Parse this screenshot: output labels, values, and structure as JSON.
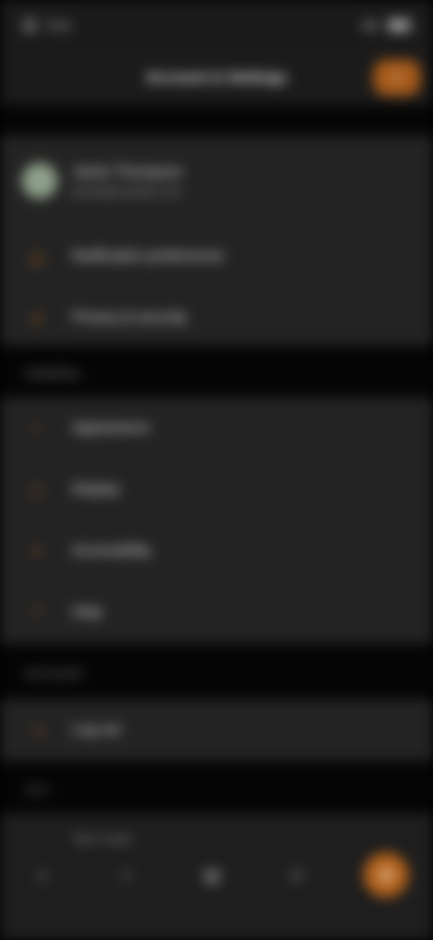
{
  "status_bar": {
    "left_text": "9:41",
    "right_text": "5G"
  },
  "header": {
    "title": "Account & Settings",
    "action_icon": "plus-icon"
  },
  "profile_card": {
    "name": "Jamie Thompson",
    "subtitle": "jamie@example.com",
    "items": [
      {
        "label": "Notification preferences",
        "icon": "bell-icon"
      },
      {
        "label": "Privacy & security",
        "icon": "lock-icon"
      }
    ]
  },
  "section_general": {
    "header": "GENERAL",
    "items": [
      {
        "label": "Appearance",
        "icon": "palette-icon"
      },
      {
        "label": "Display",
        "icon": "display-icon"
      },
      {
        "label": "Accessibility",
        "icon": "accessibility-icon"
      },
      {
        "label": "Help",
        "icon": "help-icon"
      }
    ]
  },
  "section_account": {
    "header": "ACCOUNT",
    "items": [
      {
        "label": "Log out",
        "icon": "logout-icon"
      }
    ]
  },
  "section_footer": {
    "header": "v2.3"
  },
  "bottom_nav": {
    "caption": "Tap to open",
    "items": [
      {
        "icon": "home-icon",
        "glyph": "⌂"
      },
      {
        "icon": "search-icon",
        "glyph": "⌕"
      },
      {
        "icon": "library-icon",
        "glyph": "▤"
      },
      {
        "icon": "profile-icon",
        "glyph": "☺"
      },
      {
        "icon": "settings-icon",
        "glyph": "⚙"
      }
    ]
  },
  "colors": {
    "accent": "#b2621c",
    "card": "#232323",
    "header": "#1b1b1b"
  }
}
